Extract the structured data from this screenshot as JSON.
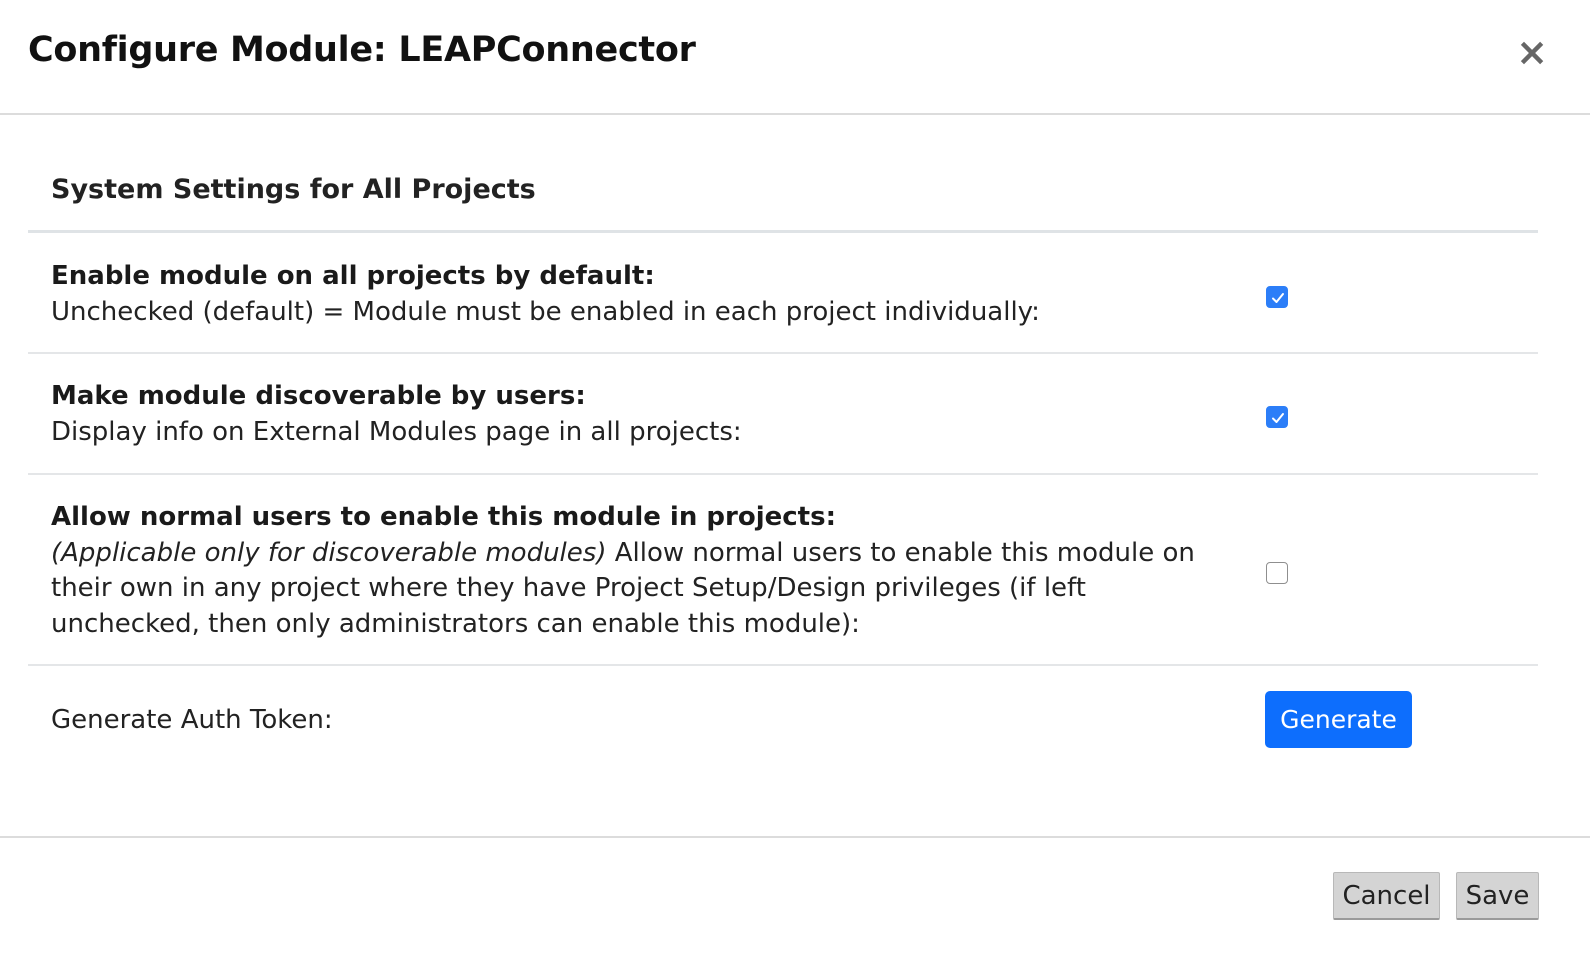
{
  "modal": {
    "title": "Configure Module: LEAPConnector",
    "close_icon": "close-icon",
    "close_glyph": "×"
  },
  "section": {
    "title": "System Settings for All Projects"
  },
  "settings": [
    {
      "label": "Enable module on all projects by default:",
      "description": "Unchecked (default) = Module must be enabled in each project individually:",
      "checked": true
    },
    {
      "label": "Make module discoverable by users:",
      "description": "Display info on External Modules page in all projects:",
      "checked": true
    },
    {
      "label": "Allow normal users to enable this module in projects:",
      "description_italic": "(Applicable only for discoverable modules)",
      "description": " Allow normal users to enable this module on their own in any project where they have Project Setup/Design privileges (if left unchecked, then only administrators can enable this module):",
      "checked": false
    }
  ],
  "auth_token": {
    "label": "Generate Auth Token:",
    "button_label": "Generate"
  },
  "footer": {
    "cancel_label": "Cancel",
    "save_label": "Save"
  },
  "colors": {
    "primary": "#0d6efd",
    "checkbox_checked": "#2c7ef8",
    "footer_button": "#d4d4d4"
  }
}
